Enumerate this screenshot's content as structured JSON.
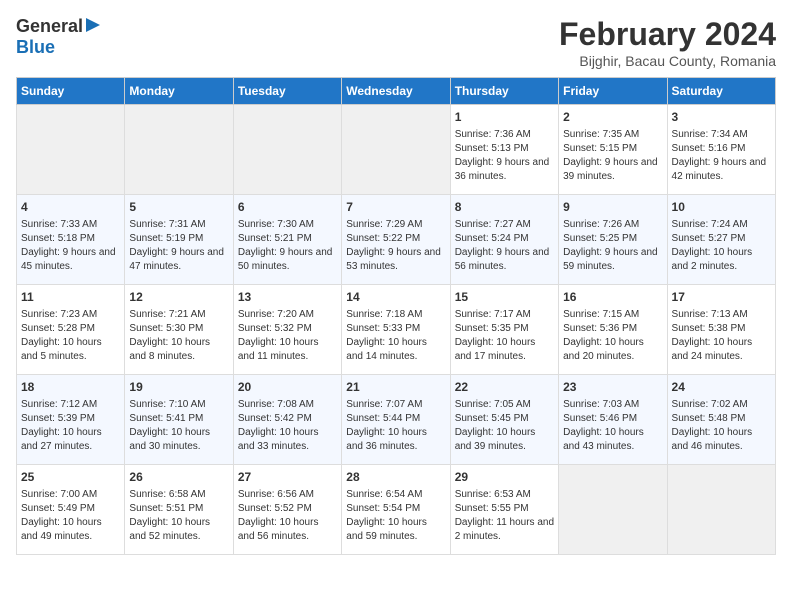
{
  "header": {
    "logo_general": "General",
    "logo_blue": "Blue",
    "title": "February 2024",
    "subtitle": "Bijghir, Bacau County, Romania"
  },
  "weekdays": [
    "Sunday",
    "Monday",
    "Tuesday",
    "Wednesday",
    "Thursday",
    "Friday",
    "Saturday"
  ],
  "weeks": [
    [
      {
        "day": "",
        "sunrise": "",
        "sunset": "",
        "daylight": "",
        "empty": true
      },
      {
        "day": "",
        "sunrise": "",
        "sunset": "",
        "daylight": "",
        "empty": true
      },
      {
        "day": "",
        "sunrise": "",
        "sunset": "",
        "daylight": "",
        "empty": true
      },
      {
        "day": "",
        "sunrise": "",
        "sunset": "",
        "daylight": "",
        "empty": true
      },
      {
        "day": "1",
        "sunrise": "Sunrise: 7:36 AM",
        "sunset": "Sunset: 5:13 PM",
        "daylight": "Daylight: 9 hours and 36 minutes."
      },
      {
        "day": "2",
        "sunrise": "Sunrise: 7:35 AM",
        "sunset": "Sunset: 5:15 PM",
        "daylight": "Daylight: 9 hours and 39 minutes."
      },
      {
        "day": "3",
        "sunrise": "Sunrise: 7:34 AM",
        "sunset": "Sunset: 5:16 PM",
        "daylight": "Daylight: 9 hours and 42 minutes."
      }
    ],
    [
      {
        "day": "4",
        "sunrise": "Sunrise: 7:33 AM",
        "sunset": "Sunset: 5:18 PM",
        "daylight": "Daylight: 9 hours and 45 minutes."
      },
      {
        "day": "5",
        "sunrise": "Sunrise: 7:31 AM",
        "sunset": "Sunset: 5:19 PM",
        "daylight": "Daylight: 9 hours and 47 minutes."
      },
      {
        "day": "6",
        "sunrise": "Sunrise: 7:30 AM",
        "sunset": "Sunset: 5:21 PM",
        "daylight": "Daylight: 9 hours and 50 minutes."
      },
      {
        "day": "7",
        "sunrise": "Sunrise: 7:29 AM",
        "sunset": "Sunset: 5:22 PM",
        "daylight": "Daylight: 9 hours and 53 minutes."
      },
      {
        "day": "8",
        "sunrise": "Sunrise: 7:27 AM",
        "sunset": "Sunset: 5:24 PM",
        "daylight": "Daylight: 9 hours and 56 minutes."
      },
      {
        "day": "9",
        "sunrise": "Sunrise: 7:26 AM",
        "sunset": "Sunset: 5:25 PM",
        "daylight": "Daylight: 9 hours and 59 minutes."
      },
      {
        "day": "10",
        "sunrise": "Sunrise: 7:24 AM",
        "sunset": "Sunset: 5:27 PM",
        "daylight": "Daylight: 10 hours and 2 minutes."
      }
    ],
    [
      {
        "day": "11",
        "sunrise": "Sunrise: 7:23 AM",
        "sunset": "Sunset: 5:28 PM",
        "daylight": "Daylight: 10 hours and 5 minutes."
      },
      {
        "day": "12",
        "sunrise": "Sunrise: 7:21 AM",
        "sunset": "Sunset: 5:30 PM",
        "daylight": "Daylight: 10 hours and 8 minutes."
      },
      {
        "day": "13",
        "sunrise": "Sunrise: 7:20 AM",
        "sunset": "Sunset: 5:32 PM",
        "daylight": "Daylight: 10 hours and 11 minutes."
      },
      {
        "day": "14",
        "sunrise": "Sunrise: 7:18 AM",
        "sunset": "Sunset: 5:33 PM",
        "daylight": "Daylight: 10 hours and 14 minutes."
      },
      {
        "day": "15",
        "sunrise": "Sunrise: 7:17 AM",
        "sunset": "Sunset: 5:35 PM",
        "daylight": "Daylight: 10 hours and 17 minutes."
      },
      {
        "day": "16",
        "sunrise": "Sunrise: 7:15 AM",
        "sunset": "Sunset: 5:36 PM",
        "daylight": "Daylight: 10 hours and 20 minutes."
      },
      {
        "day": "17",
        "sunrise": "Sunrise: 7:13 AM",
        "sunset": "Sunset: 5:38 PM",
        "daylight": "Daylight: 10 hours and 24 minutes."
      }
    ],
    [
      {
        "day": "18",
        "sunrise": "Sunrise: 7:12 AM",
        "sunset": "Sunset: 5:39 PM",
        "daylight": "Daylight: 10 hours and 27 minutes."
      },
      {
        "day": "19",
        "sunrise": "Sunrise: 7:10 AM",
        "sunset": "Sunset: 5:41 PM",
        "daylight": "Daylight: 10 hours and 30 minutes."
      },
      {
        "day": "20",
        "sunrise": "Sunrise: 7:08 AM",
        "sunset": "Sunset: 5:42 PM",
        "daylight": "Daylight: 10 hours and 33 minutes."
      },
      {
        "day": "21",
        "sunrise": "Sunrise: 7:07 AM",
        "sunset": "Sunset: 5:44 PM",
        "daylight": "Daylight: 10 hours and 36 minutes."
      },
      {
        "day": "22",
        "sunrise": "Sunrise: 7:05 AM",
        "sunset": "Sunset: 5:45 PM",
        "daylight": "Daylight: 10 hours and 39 minutes."
      },
      {
        "day": "23",
        "sunrise": "Sunrise: 7:03 AM",
        "sunset": "Sunset: 5:46 PM",
        "daylight": "Daylight: 10 hours and 43 minutes."
      },
      {
        "day": "24",
        "sunrise": "Sunrise: 7:02 AM",
        "sunset": "Sunset: 5:48 PM",
        "daylight": "Daylight: 10 hours and 46 minutes."
      }
    ],
    [
      {
        "day": "25",
        "sunrise": "Sunrise: 7:00 AM",
        "sunset": "Sunset: 5:49 PM",
        "daylight": "Daylight: 10 hours and 49 minutes."
      },
      {
        "day": "26",
        "sunrise": "Sunrise: 6:58 AM",
        "sunset": "Sunset: 5:51 PM",
        "daylight": "Daylight: 10 hours and 52 minutes."
      },
      {
        "day": "27",
        "sunrise": "Sunrise: 6:56 AM",
        "sunset": "Sunset: 5:52 PM",
        "daylight": "Daylight: 10 hours and 56 minutes."
      },
      {
        "day": "28",
        "sunrise": "Sunrise: 6:54 AM",
        "sunset": "Sunset: 5:54 PM",
        "daylight": "Daylight: 10 hours and 59 minutes."
      },
      {
        "day": "29",
        "sunrise": "Sunrise: 6:53 AM",
        "sunset": "Sunset: 5:55 PM",
        "daylight": "Daylight: 11 hours and 2 minutes."
      },
      {
        "day": "",
        "sunrise": "",
        "sunset": "",
        "daylight": "",
        "empty": true
      },
      {
        "day": "",
        "sunrise": "",
        "sunset": "",
        "daylight": "",
        "empty": true
      }
    ]
  ]
}
